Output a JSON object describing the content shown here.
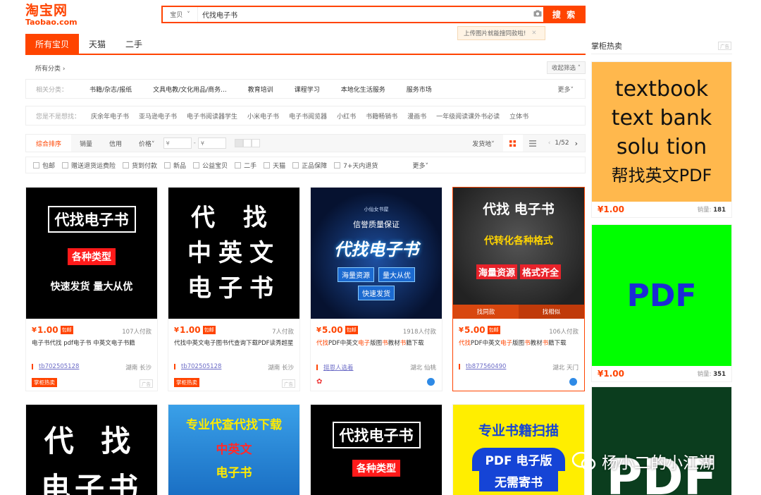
{
  "header": {
    "logo_cn": "淘宝网",
    "logo_en": "Taobao.com",
    "search_type": "宝贝",
    "search_value": "代找电子书",
    "search_button": "搜 索",
    "tooltip": "上传图片就能搜同款啦!"
  },
  "tabs": [
    "所有宝贝",
    "天猫",
    "二手"
  ],
  "breadcrumb": "所有分类 ›",
  "collapse_label": "收起筛选 ˄",
  "related": {
    "label": "相关分类：",
    "items": [
      "书籍/杂志/报纸",
      "文具电教/文化用品/商务...",
      "教育培训",
      "课程学习",
      "本地化生活服务",
      "服务市场"
    ],
    "more": "更多˅"
  },
  "suggest": {
    "label": "您是不是想找：",
    "items": [
      "庆余年电子书",
      "亚马逊电子书",
      "电子书阅读器学生",
      "小米电子书",
      "电子书阅览器",
      "小红书",
      "书籍畅销书",
      "漫画书",
      "一年级阅读课外书必读",
      "立体书"
    ]
  },
  "sort": {
    "items": [
      "综合排序",
      "销量",
      "信用",
      "价格˅"
    ],
    "price_from": "¥",
    "price_to": "¥",
    "ship_from": "发货地˅",
    "page": "1/52"
  },
  "filters": [
    "包邮",
    "赠送退货运费险",
    "货到付款",
    "新品",
    "公益宝贝",
    "二手",
    "天猫",
    "正品保障",
    "7+天内退货"
  ],
  "filters_more": "更多˅",
  "products": [
    {
      "img_lines": [
        "代找电子书",
        "各种类型",
        "快速发货 量大从优"
      ],
      "price": "1.00",
      "baoyou": "包邮",
      "paid": "107人付款",
      "title": "电子书代找 pdf电子书 中英文电子书籍",
      "shop": "tb702505128",
      "loc": "湖南 长沙",
      "tag": "掌柜热卖",
      "ad": "广告"
    },
    {
      "img_lines": [
        "代 找",
        "中英文",
        "电子书"
      ],
      "price": "1.00",
      "baoyou": "包邮",
      "paid": "7人付款",
      "title": "代找中英文电子图书代查询下载PDF读秀超星",
      "shop": "tb702505128",
      "loc": "湖南 长沙",
      "tag": "掌柜热卖",
      "ad": "广告"
    },
    {
      "img_lines": [
        "小仙女书屋",
        "信誉质量保证",
        "代找电子书",
        "海量资源",
        "量大从优",
        "快速发货"
      ],
      "price": "5.00",
      "baoyou": "包邮",
      "paid": "1918人付款",
      "title_parts": [
        "代找",
        "PDF中英文",
        "电子",
        "版图",
        "书",
        "教材",
        "书",
        "籍下载"
      ],
      "shop": "挺恩人选着",
      "loc": "湖北 仙桃"
    },
    {
      "img_lines": [
        "代找 电子书",
        "代转化各种格式",
        "海量资源",
        "格式齐全"
      ],
      "price": "5.00",
      "baoyou": "包邮",
      "paid": "106人付款",
      "title_parts": [
        "代找",
        "PDF中英文",
        "电子",
        "版图",
        "书",
        "教材",
        "书",
        "籍下载"
      ],
      "shop": "tb877560490",
      "loc": "湖北 天门",
      "hover": [
        "找同款",
        "找相似"
      ]
    },
    {
      "img_lines": [
        "代 找",
        "电子书"
      ]
    },
    {
      "img_lines": [
        "专业代查代找下载",
        "中英文",
        "电子书"
      ]
    },
    {
      "img_lines": [
        "代找电子书",
        "各种类型"
      ]
    },
    {
      "img_lines": [
        "专业书籍扫描",
        "PDF 电子版",
        "无需寄书"
      ]
    }
  ],
  "right": {
    "title": "掌柜热卖",
    "ad": "广告",
    "items": [
      {
        "img_lines": [
          "textbook",
          "text bank",
          "solu tion",
          "帮找英文PDF"
        ],
        "price": "¥1.00",
        "sold_label": "销量:",
        "sold": "181",
        "bg": "#ffb84d"
      },
      {
        "img_lines": [
          "PDF"
        ],
        "price": "¥1.00",
        "sold_label": "销量:",
        "sold": "351",
        "bg": "#00ff00"
      },
      {
        "img_lines": [
          "PDF"
        ],
        "bg": "#0b3d1e"
      }
    ]
  },
  "watermark": "杨小二的小江湖",
  "colors": {
    "accent": "#ff4400",
    "link": "#6d6dc7"
  }
}
